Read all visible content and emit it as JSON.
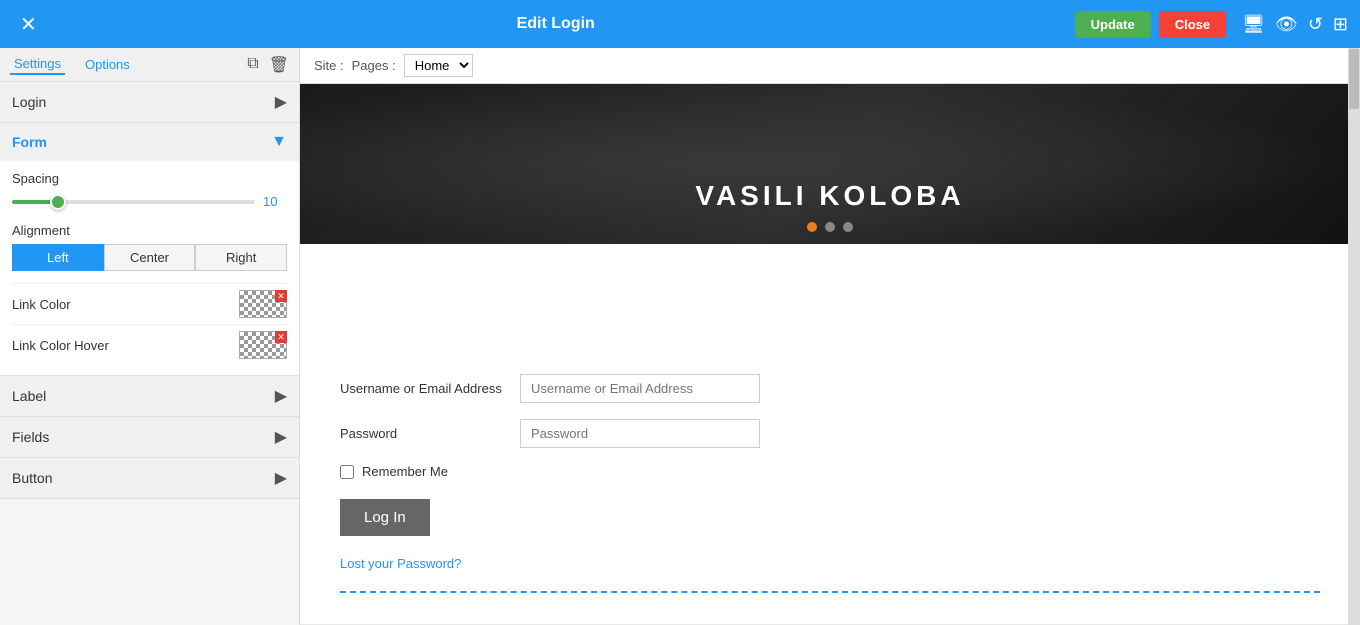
{
  "topbar": {
    "title": "Edit Login",
    "close_label": "✕",
    "update_label": "Update",
    "close_btn_label": "Close"
  },
  "site_bar": {
    "site_label": "Site :",
    "pages_label": "Pages :",
    "pages_selected": "Home"
  },
  "sidebar": {
    "settings_tab": "Settings",
    "options_tab": "Options",
    "sections": [
      {
        "id": "login",
        "label": "Login",
        "expanded": false
      },
      {
        "id": "form",
        "label": "Form",
        "expanded": true
      },
      {
        "id": "label",
        "label": "Label",
        "expanded": false
      },
      {
        "id": "fields",
        "label": "Fields",
        "expanded": false
      },
      {
        "id": "button",
        "label": "Button",
        "expanded": false
      }
    ],
    "form": {
      "spacing_label": "Spacing",
      "spacing_value": "10",
      "alignment_label": "Alignment",
      "alignment_options": [
        "Left",
        "Center",
        "Right"
      ],
      "alignment_active": "Left",
      "link_color_label": "Link Color",
      "link_color_hover_label": "Link Color Hover"
    }
  },
  "hero": {
    "title": "VASILI KOLOBA",
    "dots": [
      {
        "active": true
      },
      {
        "active": false
      },
      {
        "active": false
      }
    ]
  },
  "login_form": {
    "username_label": "Username or Email Address",
    "username_placeholder": "Username or Email Address",
    "password_label": "Password",
    "password_placeholder": "Password",
    "remember_label": "Remember Me",
    "login_button": "Log In",
    "lost_password": "Lost your Password?"
  }
}
